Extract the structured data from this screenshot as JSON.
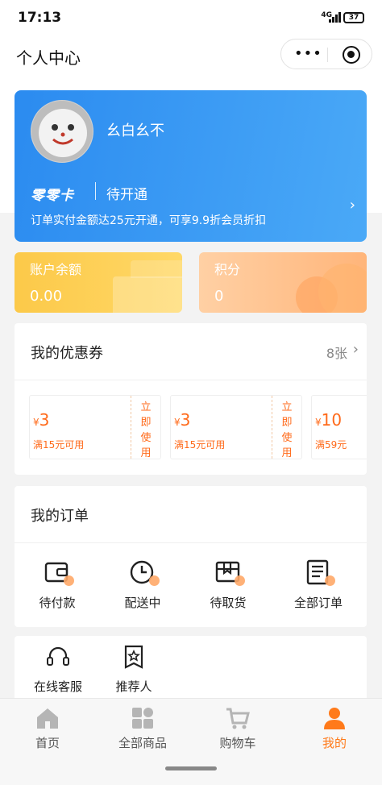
{
  "status_bar": {
    "time": "17:13",
    "network": "4G",
    "battery": "37"
  },
  "nav": {
    "title": "个人中心",
    "more_icon": "more-dots-icon",
    "close_icon": "target-icon"
  },
  "profile": {
    "username": "幺白幺不",
    "avatar_icon": "avatar-face"
  },
  "member_card": {
    "logo": "零零卡",
    "status": "待开通",
    "description": "订单实付金额达25元开通，可享9.9折会员折扣",
    "bg_color": "#2b8bf0"
  },
  "balance": {
    "label": "账户余额",
    "value": "0.00"
  },
  "points": {
    "label": "积分",
    "value": "0"
  },
  "coupons": {
    "title": "我的优惠券",
    "count": "8张",
    "items": [
      {
        "currency": "¥",
        "amount": "3",
        "condition": "满15元可用",
        "action": [
          "立",
          "即",
          "使",
          "用"
        ]
      },
      {
        "currency": "¥",
        "amount": "3",
        "condition": "满15元可用",
        "action": [
          "立",
          "即",
          "使",
          "用"
        ]
      },
      {
        "currency": "¥",
        "amount": "10",
        "condition": "满59元"
      }
    ],
    "accent_color": "#ff6a1a"
  },
  "orders": {
    "title": "我的订单",
    "items": [
      {
        "label": "待付款",
        "icon": "wallet-icon"
      },
      {
        "label": "配送中",
        "icon": "clock-icon"
      },
      {
        "label": "待取货",
        "icon": "package-icon"
      },
      {
        "label": "全部订单",
        "icon": "order-list-icon"
      }
    ]
  },
  "services": {
    "items": [
      {
        "label": "在线客服",
        "icon": "headset-icon"
      },
      {
        "label": "推荐人",
        "icon": "referrer-icon"
      }
    ]
  },
  "tabbar": {
    "items": [
      {
        "label": "首页",
        "icon": "home-icon",
        "active": false
      },
      {
        "label": "全部商品",
        "icon": "grid-icon",
        "active": false
      },
      {
        "label": "购物车",
        "icon": "cart-icon",
        "active": false
      },
      {
        "label": "我的",
        "icon": "user-icon",
        "active": true
      }
    ],
    "active_color": "#ff7a1a"
  }
}
